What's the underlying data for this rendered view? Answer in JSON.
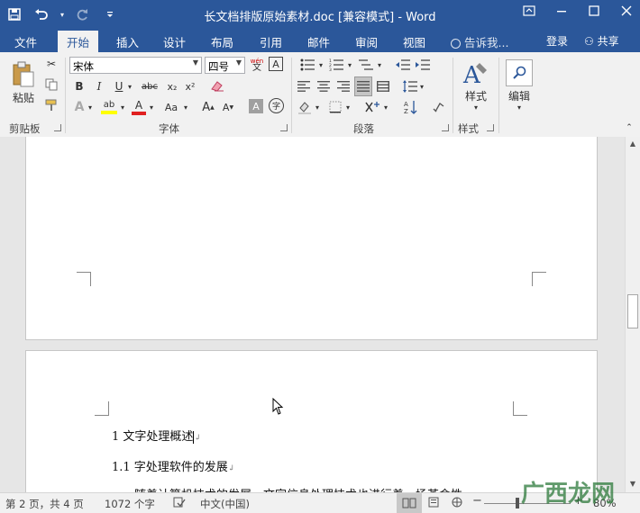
{
  "app": {
    "window_title": "长文档排版原始素材.doc [兼容模式] - Word",
    "qat": [
      "save-icon",
      "undo-icon",
      "redo-icon",
      "customize-icon"
    ],
    "window_controls": [
      "ribbon-display-icon",
      "minimize-icon",
      "restore-icon",
      "close-icon"
    ]
  },
  "tabs": {
    "file": "文件",
    "home": "开始",
    "insert": "插入",
    "design": "设计",
    "layout": "布局",
    "references": "引用",
    "mailings": "邮件",
    "review": "审阅",
    "view": "视图",
    "tellme": "告诉我...",
    "login": "登录",
    "share": "共享"
  },
  "ribbon": {
    "clipboard": {
      "paste": "粘贴",
      "label": "剪贴板"
    },
    "font": {
      "name": "宋体",
      "size": "四号",
      "wen_top": "wén",
      "wen_bottom": "文",
      "a_box": "A",
      "bold": "B",
      "italic": "I",
      "underline": "U",
      "strike": "abc",
      "subscript": "x₂",
      "superscript": "x²",
      "text_effects": "A",
      "highlight": "ab",
      "font_color": "A",
      "change_case": "Aa",
      "grow": "A",
      "shrink": "A",
      "char_shading": "A",
      "enclose": "字",
      "label": "字体"
    },
    "paragraph": {
      "label": "段落"
    },
    "styles": {
      "button": "样式",
      "label": "样式"
    },
    "editing": {
      "button": "编辑"
    },
    "colors": {
      "highlight": "#ffff00",
      "font_color": "#e02020",
      "accent": "#2b579a"
    }
  },
  "document": {
    "heading1": "1 文字处理概述",
    "heading2": "1.1  字处理软件的发展",
    "body_partial": "随着计算机技术的发展，文字信息处理技术也进行着一场革命性"
  },
  "status": {
    "page": "第 2 页，共 4 页",
    "words": "1072 个字",
    "language": "中文(中国)",
    "zoom": "80%",
    "zoom_value": 80
  },
  "watermark": {
    "text": "广西龙网"
  }
}
